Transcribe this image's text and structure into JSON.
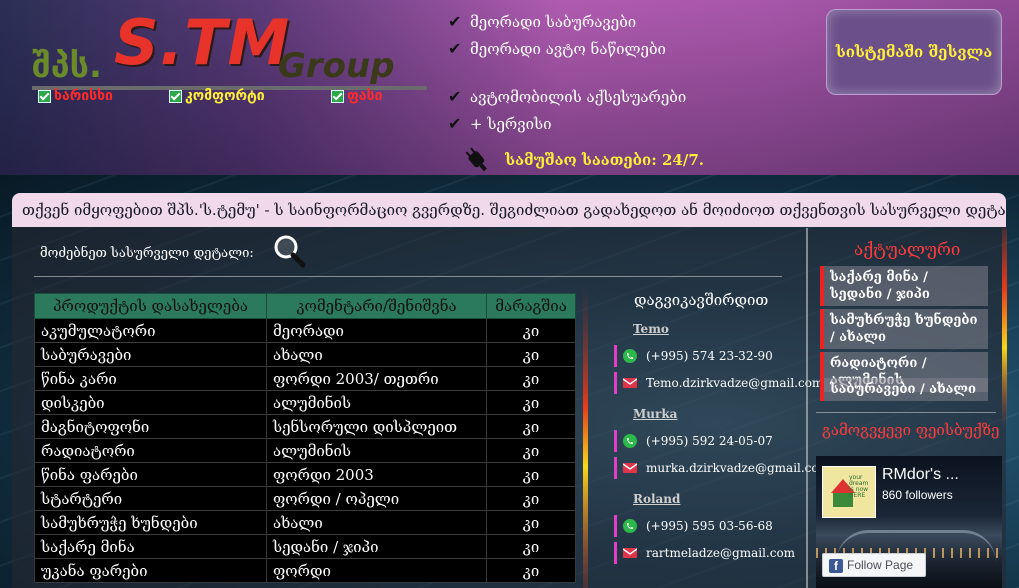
{
  "header": {
    "logo": {
      "prefix": "შპს.",
      "brand": "S.TM",
      "suffix": "Group"
    },
    "badges": [
      {
        "label": "ხარისხი",
        "color": "#ff2a2a"
      },
      {
        "label": "კომფორტი",
        "color": "#ffef3a"
      },
      {
        "label": "ფასი",
        "color": "#ff2a2a"
      }
    ],
    "services": [
      "მეორადი საბურავები",
      "მეორადი ავტო ნაწილები",
      "ავტომობილის აქსესუარები",
      "+ სერვისი"
    ],
    "hours": "სამუშაო საათები: 24/7.",
    "login_label": "სისტემაში შესვლა"
  },
  "welcome": "თქვენ იმყოფებით შპს.'ს.ტემუ' - ს საინფორმაციო გვერდზე. შეგიძლიათ გადახედოთ ან მოიძიოთ თქვენთვის სასურველი დეტალი.",
  "search": {
    "label": "მოძებნეთ სასურველი დეტალი:"
  },
  "products": {
    "headers": [
      "პროდუქტის დასახელება",
      "კომენტარი/შენიშვნა",
      "მარაგშია"
    ],
    "rows": [
      [
        "აკუმულატორი",
        "მეორადი",
        "კი"
      ],
      [
        "საბურავები",
        "ახალი",
        "კი"
      ],
      [
        "წინა კარი",
        "ფორდი 2003/ თეთრი",
        "კი"
      ],
      [
        "დისკები",
        "ალუმინის",
        "კი"
      ],
      [
        "მაგნიტოფონი",
        "სენსორული დისპლეით",
        "კი"
      ],
      [
        "რადიატორი",
        "ალუმინის",
        "კი"
      ],
      [
        "წინა ფარები",
        "ფორდი 2003",
        "კი"
      ],
      [
        "სტარტერი",
        "ფორდი / ოპელი",
        "კი"
      ],
      [
        "სამუხრუჭე ხუნდები",
        "ახალი",
        "კი"
      ],
      [
        "საქარე მინა",
        "სედანი / ჯიპი",
        "კი"
      ],
      [
        "უკანა ფარები",
        "ფორდი",
        "კი"
      ]
    ]
  },
  "contacts": {
    "title": "დაგვიკავშირდით",
    "people": [
      {
        "name": "Temo",
        "phone": "(+995) 574 23-32-90",
        "email": "Temo.dzirkvadze@gmail.com"
      },
      {
        "name": "Murka",
        "phone": "(+995) 592 24-05-07",
        "email": "murka.dzirkvadze@gmail.com"
      },
      {
        "name": "Roland",
        "phone": "(+995) 595 03-56-68",
        "email": "rartmeladze@gmail.com"
      }
    ]
  },
  "sidebar": {
    "news_title": "აქტუალური",
    "news": [
      "საქარე მინა / სედანი / ჯიპი",
      "სამუხრუჭე ხუნდები / ახალი",
      "რადიატორი / ალუმინის",
      "საბურავები / ახალი"
    ],
    "facebook_title": "გამოგვყევი ფეისბუქზე",
    "facebook": {
      "page_name": "RMdor's ...",
      "followers": "860 followers",
      "follow_label": "Follow Page",
      "tagline": "your dream is now HERE"
    }
  },
  "colors": {
    "accent_yellow": "#ffef3a",
    "accent_red": "#ff3b3b",
    "table_header": "#2b7a5d",
    "header_purple": "#b05bb0"
  }
}
